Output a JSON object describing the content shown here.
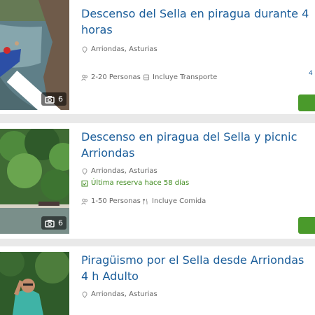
{
  "listings": [
    {
      "title": "Descenso del Sella en piragua durante 4 horas",
      "location": "Arriondas, Asturias",
      "people": "2-20 Personas",
      "feature": "Incluye Transporte",
      "photos": "6",
      "right_text": "4",
      "icons": [
        "pin-icon",
        "people-icon",
        "transport-icon",
        "camera-icon",
        "chevron-right-icon"
      ]
    },
    {
      "title": "Descenso en piragua del Sella y picnic Arriondas",
      "location": "Arriondas, Asturias",
      "last_booking": "Última reserva hace 58 días",
      "people": "1-50 Personas",
      "feature": "Incluye Comida",
      "photos": "6",
      "icons": [
        "pin-icon",
        "calendar-check-icon",
        "people-icon",
        "fork-knife-icon",
        "camera-icon"
      ]
    },
    {
      "title": "Piragüismo por el Sella desde Arriondas 4 h Adulto",
      "location": "Arriondas, Asturias",
      "icons": [
        "pin-icon"
      ]
    }
  ],
  "colors": {
    "title": "#1a5d9a",
    "accent_button": "#4a9a2b",
    "booking_text": "#3f8b1e"
  }
}
